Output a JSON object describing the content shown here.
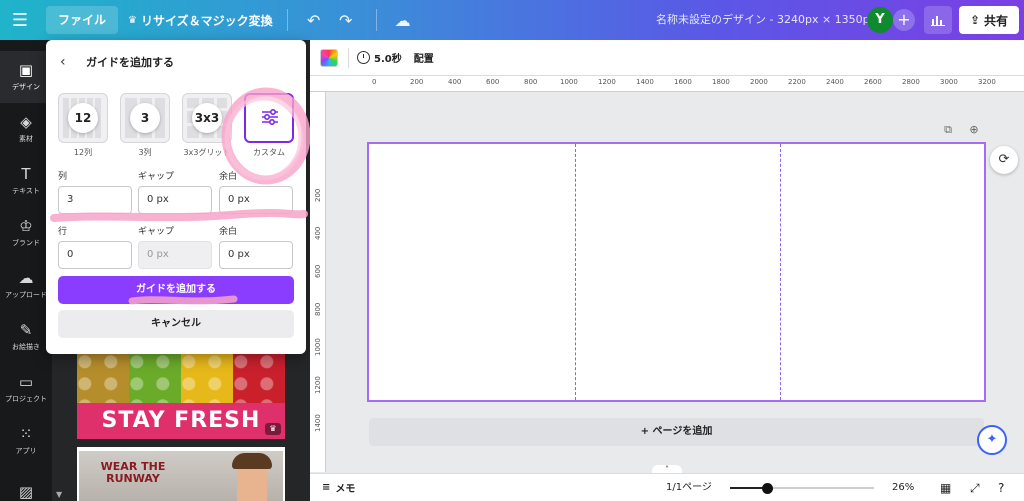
{
  "topbar": {
    "file_label": "ファイル",
    "resize_label": "リサイズ＆マジック変換",
    "design_title": "名称未設定のデザイン - 3240px × 1350px",
    "avatar_initial": "Y",
    "share_label": "共有"
  },
  "rail": {
    "items": [
      {
        "icon": "design-icon",
        "label": "デザイン"
      },
      {
        "icon": "elements-icon",
        "label": "素材"
      },
      {
        "icon": "text-icon",
        "label": "テキスト"
      },
      {
        "icon": "brand-icon",
        "label": "ブランド"
      },
      {
        "icon": "upload-icon",
        "label": "アップロード"
      },
      {
        "icon": "draw-icon",
        "label": "お絵描き"
      },
      {
        "icon": "project-icon",
        "label": "プロジェクト"
      },
      {
        "icon": "apps-icon",
        "label": "アプリ"
      }
    ]
  },
  "panel": {
    "template1_text": "STAY FRESH",
    "template2_text": "WEAR THE RUNWAY"
  },
  "popup": {
    "title": "ガイドを追加する",
    "presets": [
      {
        "badge": "12",
        "label": "12列"
      },
      {
        "badge": "3",
        "label": "3列"
      },
      {
        "badge": "3x3",
        "label": "3x3グリッド"
      },
      {
        "badge": "",
        "label": "カスタム"
      }
    ],
    "columns_label": "列",
    "columns_gap_label": "ギャップ",
    "columns_margin_label": "余白",
    "columns_value": "3",
    "columns_gap_value": "0 px",
    "columns_margin_value": "0 px",
    "rows_label": "行",
    "rows_gap_label": "ギャップ",
    "rows_margin_label": "余白",
    "rows_value": "0",
    "rows_gap_value": "0 px",
    "rows_margin_value": "0 px",
    "add_button": "ガイドを追加する",
    "cancel_button": "キャンセル"
  },
  "context_bar": {
    "timer": "5.0秒",
    "arrange": "配置"
  },
  "ruler": {
    "h_ticks": [
      "0",
      "200",
      "400",
      "600",
      "800",
      "1000",
      "1200",
      "1400",
      "1600",
      "1800",
      "2000",
      "2200",
      "2400",
      "2600",
      "2800",
      "3000",
      "3200"
    ],
    "v_ticks": [
      "200",
      "400",
      "600",
      "800",
      "1000",
      "1200",
      "1400"
    ]
  },
  "canvas": {
    "add_page_label": "+ ページを追加",
    "guide_columns": 3
  },
  "bottombar": {
    "notes_label": "メモ",
    "pages_label": "1/1ページ",
    "zoom_label": "26%",
    "zoom_fraction": 0.26
  },
  "colors": {
    "accent": "#8b3dff",
    "selection": "#a46cf5",
    "rail_bg": "#18191b",
    "highlight_scribble": "#f7a3c8"
  }
}
